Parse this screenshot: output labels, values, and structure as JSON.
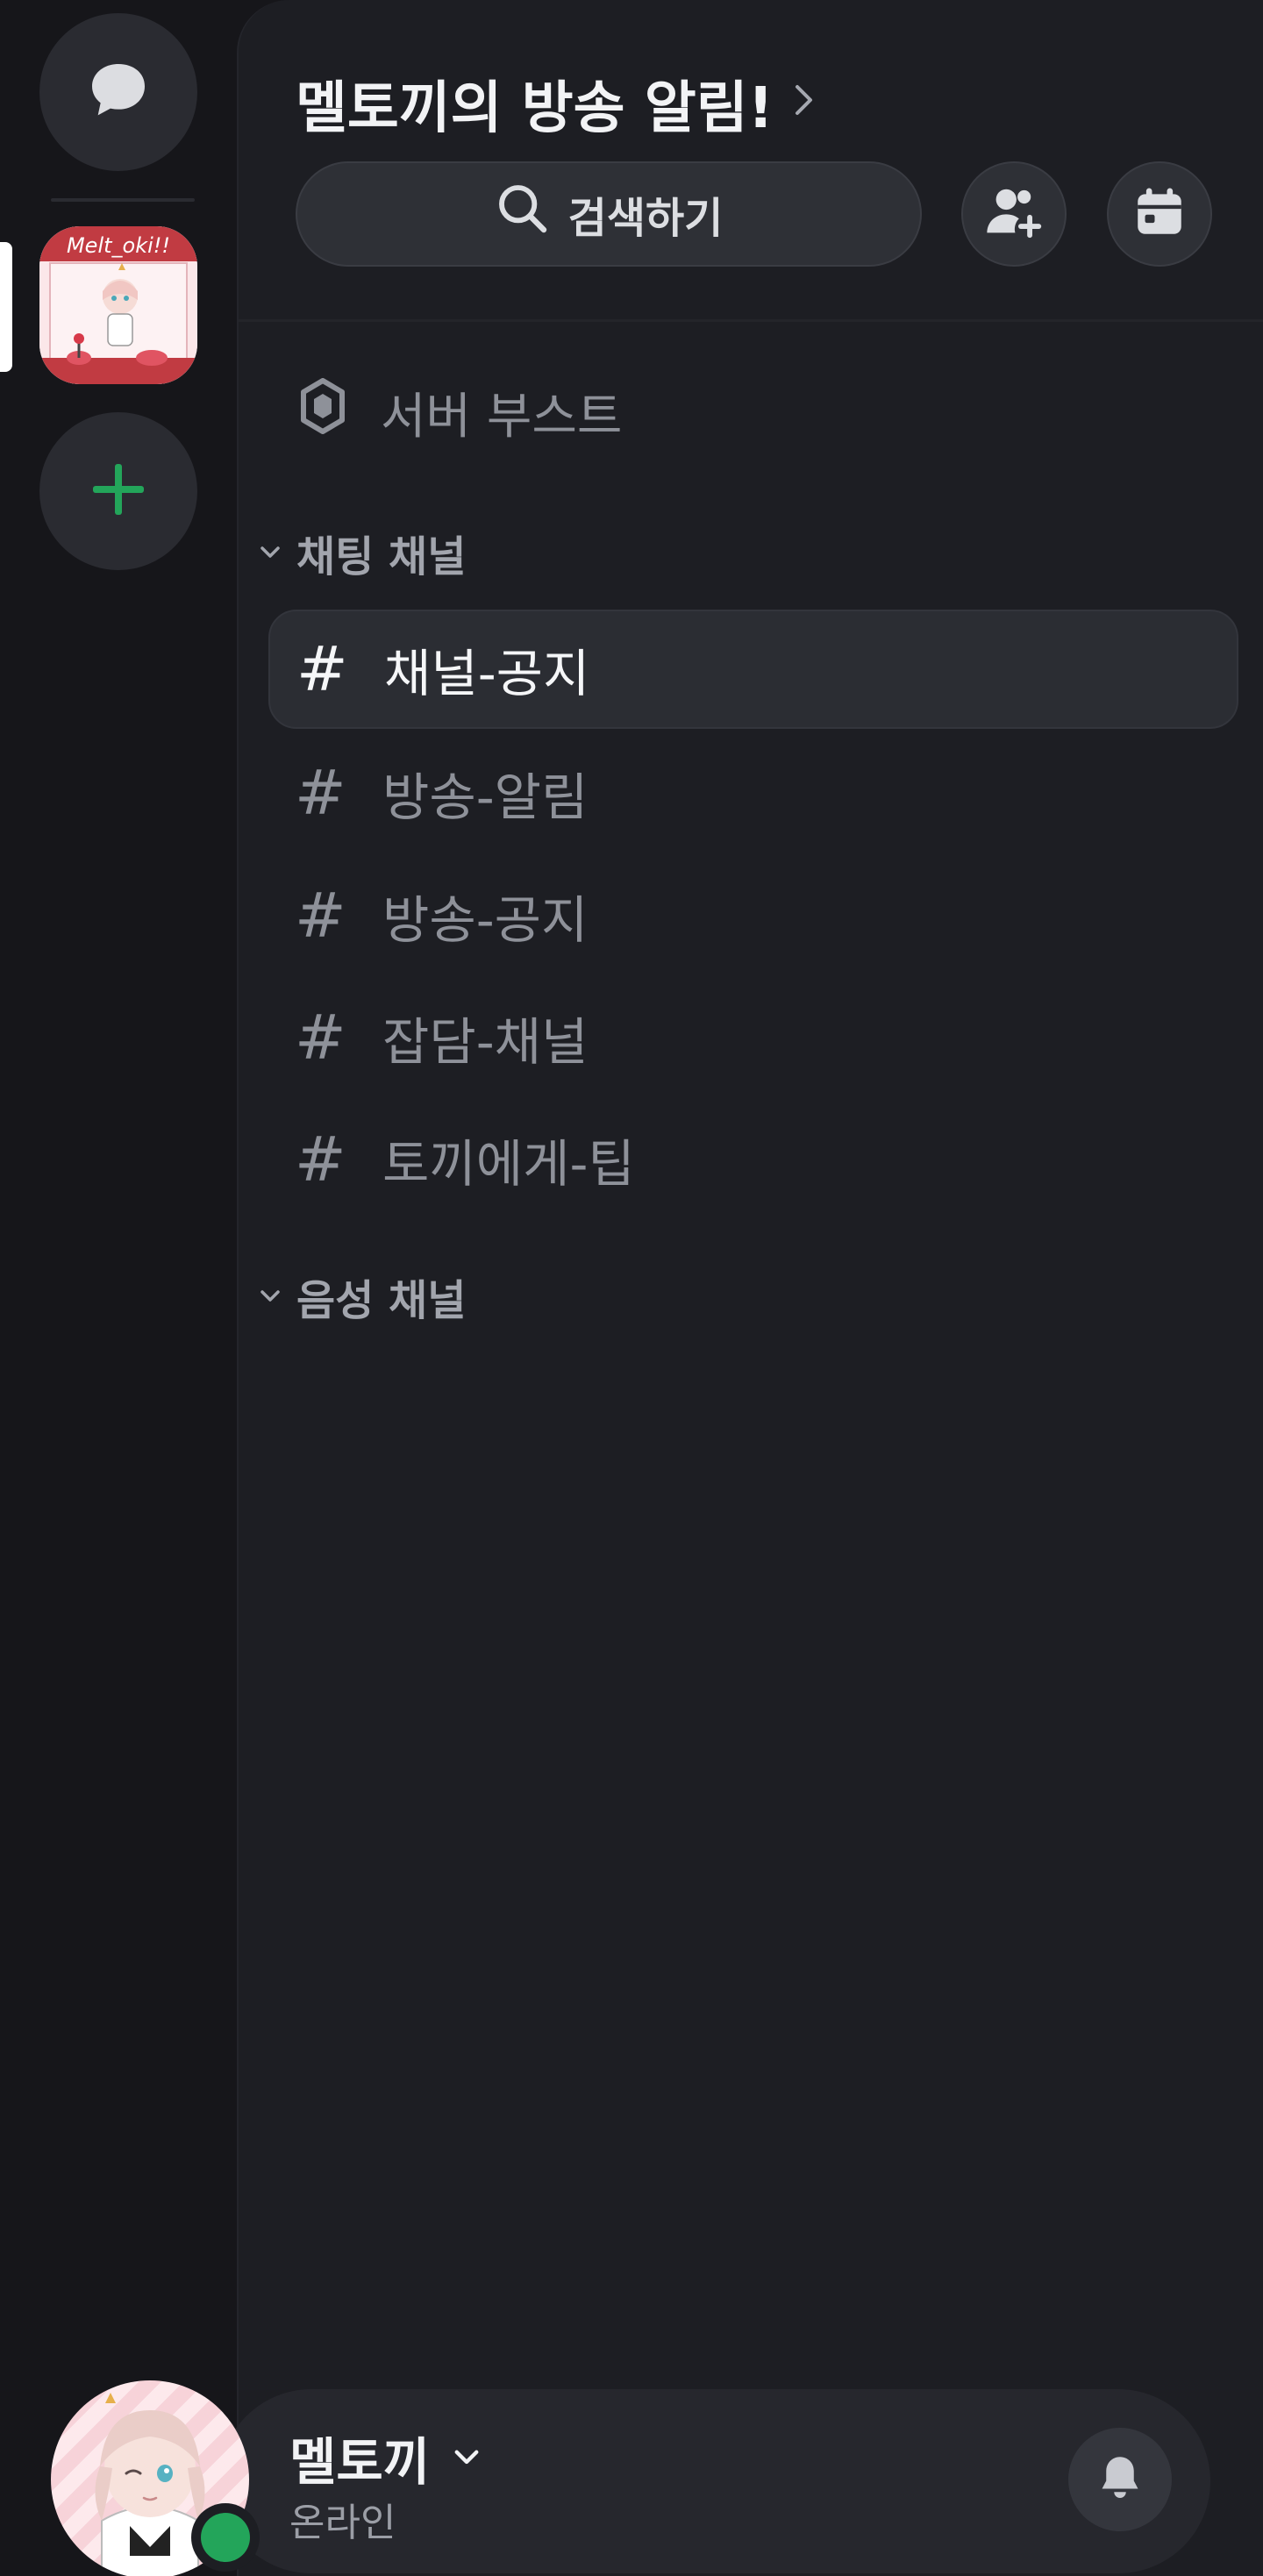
{
  "rail": {
    "dm_icon": "chat-bubble-icon",
    "server_icon": "melt-toki-server-icon",
    "server_icon_text": "Melt_oki!!",
    "add_icon": "plus-icon",
    "add_color": "#23a55a"
  },
  "header": {
    "title": "멜토끼의 방송 알림!",
    "title_icon": "chevron-right-icon",
    "search_label": "검색하기",
    "search_icon": "search-icon",
    "invite_icon": "add-member-icon",
    "events_icon": "calendar-icon"
  },
  "boost": {
    "label": "서버 부스트",
    "icon": "boost-gem-icon"
  },
  "categories": {
    "chat": {
      "label": "채팅 채널",
      "icon": "chevron-down-icon"
    },
    "voice": {
      "label": "음성 채널",
      "icon": "chevron-down-icon"
    }
  },
  "channels": [
    {
      "label": "채널-공지",
      "hash": "#",
      "active": true
    },
    {
      "label": "방송-알림",
      "hash": "#",
      "active": false
    },
    {
      "label": "방송-공지",
      "hash": "#",
      "active": false
    },
    {
      "label": "잡담-채널",
      "hash": "#",
      "active": false
    },
    {
      "label": "토끼에게-팁",
      "hash": "#",
      "active": false
    }
  ],
  "user": {
    "name": "멜토끼",
    "status": "온라인",
    "status_color": "#23a55a",
    "dropdown_icon": "chevron-down-icon",
    "bell_icon": "bell-icon"
  }
}
